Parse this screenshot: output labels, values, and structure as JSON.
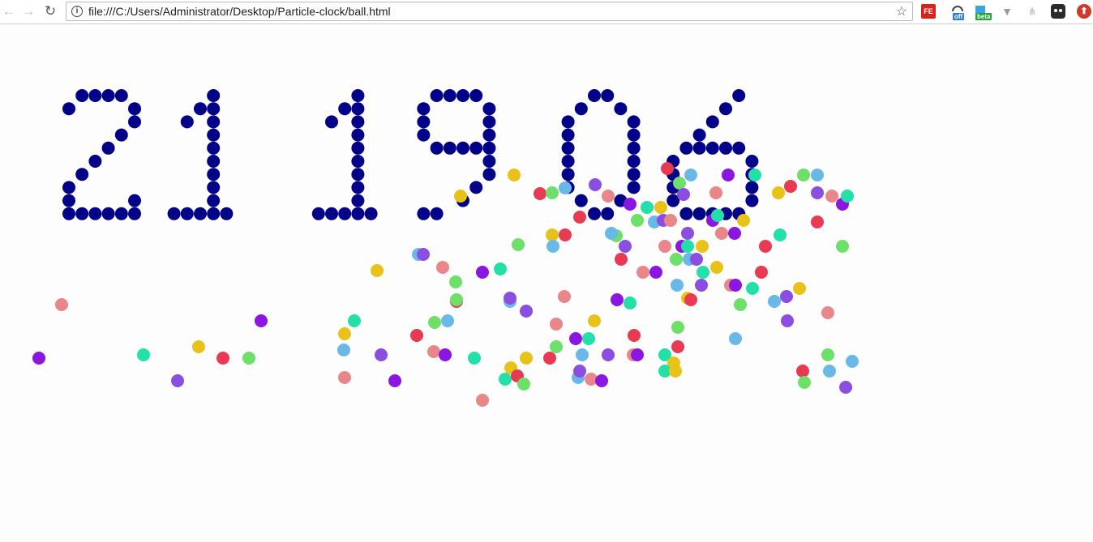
{
  "browser": {
    "url": "file:///C:/Users/Administrator/Desktop/Particle-clock/ball.html",
    "nav_back_icon": "←",
    "nav_forward_icon": "→",
    "reload_icon": "↻",
    "info_icon": "i",
    "star_icon": "☆",
    "extensions": [
      {
        "name": "fe-helper",
        "glyph": "FE"
      },
      {
        "name": "off-switch",
        "badge": "off"
      },
      {
        "name": "beta-extension",
        "badge": "beta"
      },
      {
        "name": "v-extension",
        "glyph": "▼"
      },
      {
        "name": "tree-extension",
        "glyph": "⋔"
      },
      {
        "name": "dark-extension",
        "glyph": ""
      },
      {
        "name": "red-upload-extension",
        "glyph": "⬆"
      }
    ]
  },
  "clock": {
    "text": "21 19 06",
    "digit_color": "#000088"
  },
  "particle_colors": [
    "#e83a52",
    "#8a16e0",
    "#6ab8e8",
    "#e8c218",
    "#e8868a",
    "#6ee06a",
    "#22e0a8",
    "#8a4ee0"
  ]
}
